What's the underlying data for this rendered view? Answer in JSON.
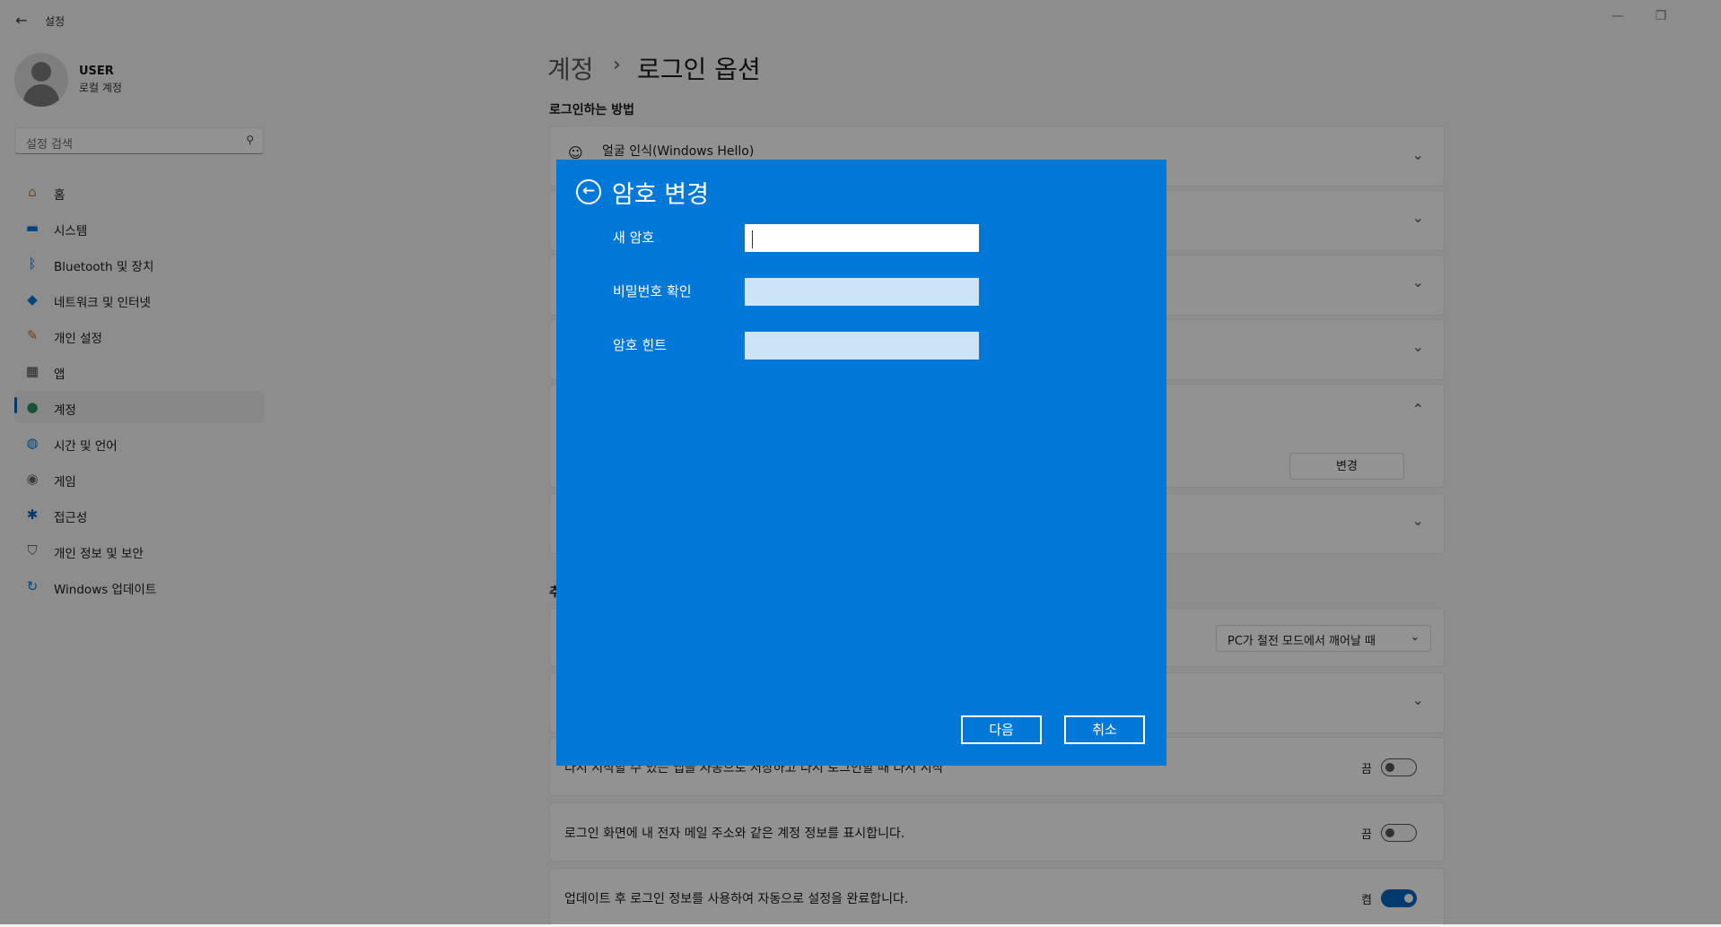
{
  "window": {
    "title": "설정",
    "back_icon": "arrow-left-icon",
    "minimize": "—",
    "restore": "❐"
  },
  "user": {
    "name": "USER",
    "account_type": "로컬 계정"
  },
  "search": {
    "placeholder": "설정 검색"
  },
  "nav": [
    {
      "label": "홈",
      "icon": "home-icon",
      "glyph": "⌂",
      "color": "#c97b3a"
    },
    {
      "label": "시스템",
      "icon": "monitor-icon",
      "glyph": "▬",
      "color": "#0078d4"
    },
    {
      "label": "Bluetooth 및 장치",
      "icon": "bluetooth-icon",
      "glyph": "ᛒ",
      "color": "#0067c0"
    },
    {
      "label": "네트워크 및 인터넷",
      "icon": "wifi-icon",
      "glyph": "◆",
      "color": "#0078d4"
    },
    {
      "label": "개인 설정",
      "icon": "brush-icon",
      "glyph": "✎",
      "color": "#c46a2a"
    },
    {
      "label": "앱",
      "icon": "apps-icon",
      "glyph": "▦",
      "color": "#444"
    },
    {
      "label": "계정",
      "icon": "account-icon",
      "glyph": "●",
      "color": "#2b8a5e",
      "active": true
    },
    {
      "label": "시간 및 언어",
      "icon": "globe-clock-icon",
      "glyph": "◍",
      "color": "#0078d4"
    },
    {
      "label": "게임",
      "icon": "gamepad-icon",
      "glyph": "◉",
      "color": "#666"
    },
    {
      "label": "접근성",
      "icon": "accessibility-icon",
      "glyph": "✱",
      "color": "#0067c0"
    },
    {
      "label": "개인 정보 및 보안",
      "icon": "shield-icon",
      "glyph": "⛉",
      "color": "#666"
    },
    {
      "label": "Windows 업데이트",
      "icon": "update-icon",
      "glyph": "↻",
      "color": "#0078d4"
    }
  ],
  "breadcrumb": {
    "parent": "계정",
    "separator": "›",
    "current": "로그인 옵션"
  },
  "main": {
    "section_title": "로그인하는 방법",
    "face_recognition": "얼굴 인식(Windows Hello)",
    "change_button": "변경",
    "wake_dropdown": "PC가 절전 모드에서 깨어날 때",
    "section2_letter": "추",
    "settings": [
      {
        "text": "다시 시작할 수 있는 앱을 자동으로 저장하고 다시 로그인할 때 다시 시작",
        "state": "끔"
      },
      {
        "text": "로그인 화면에 내 전자 메일 주소와 같은 계정 정보를 표시합니다.",
        "state": "끔"
      },
      {
        "text": "업데이트 후 로그인 정보를 사용하여 자동으로 설정을 완료합니다.",
        "state": "켬"
      }
    ]
  },
  "dialog": {
    "title": "암호 변경",
    "fields": {
      "new_password": "새 암호",
      "confirm_password": "비밀번호 확인",
      "password_hint": "암호 힌트"
    },
    "next_button": "다음",
    "cancel_button": "취소",
    "bg_color": "#0078d7"
  }
}
